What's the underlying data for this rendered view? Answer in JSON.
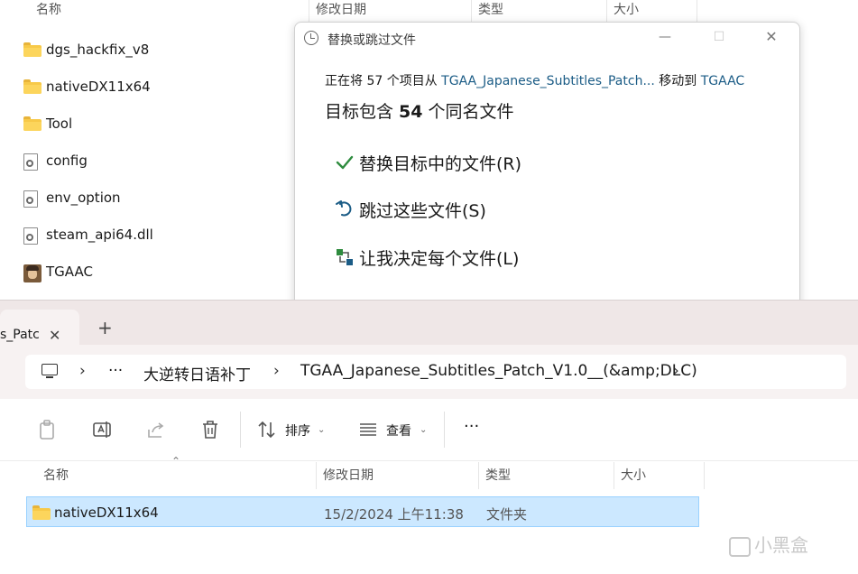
{
  "back_window": {
    "columns": [
      "名称",
      "修改日期",
      "类型",
      "大小"
    ],
    "files": [
      {
        "name": "dgs_hackfix_v8",
        "icon": "folder-icon"
      },
      {
        "name": "nativeDX11x64",
        "icon": "folder-icon"
      },
      {
        "name": "Tool",
        "icon": "folder-icon"
      },
      {
        "name": "config",
        "icon": "settings-file-icon"
      },
      {
        "name": "env_option",
        "icon": "settings-file-icon"
      },
      {
        "name": "steam_api64.dll",
        "icon": "settings-file-icon"
      },
      {
        "name": "TGAAC",
        "icon": "app-avatar-icon"
      }
    ]
  },
  "dialog": {
    "title": "替换或跳过文件",
    "line1_prefix": "正在将 57 个项目从 ",
    "line1_source": "TGAA_Japanese_Subtitles_Patch...",
    "line1_middle": " 移动到 ",
    "line1_dest": "TGAAC",
    "line2_prefix": "目标包含 ",
    "line2_count": "54",
    "line2_suffix": " 个同名文件",
    "options": {
      "replace": "替换目标中的文件(R)",
      "skip": "跳过这些文件(S)",
      "decide": "让我决定每个文件(L)"
    }
  },
  "front_window": {
    "tab_label": "s_Patc",
    "tab_close": "✕",
    "tab_new": "+",
    "address": {
      "more": "···",
      "crumb1": "大逆转日语补丁",
      "crumb2": "TGAA_Japanese_Subtitles_Patch_V1.0__(&amp;DLC)"
    },
    "toolbar": {
      "sort_label": "排序",
      "view_label": "查看",
      "more": "···"
    },
    "columns": [
      "名称",
      "修改日期",
      "类型",
      "大小"
    ],
    "rows": [
      {
        "name": "nativeDX11x64",
        "date": "15/2/2024 上午11:38",
        "type": "文件夹",
        "size": ""
      }
    ]
  },
  "watermark": "小黑盒",
  "colors": {
    "accent_link": "#1b5c86",
    "check_green": "#2e8b3e",
    "selection": "#cce8ff"
  }
}
